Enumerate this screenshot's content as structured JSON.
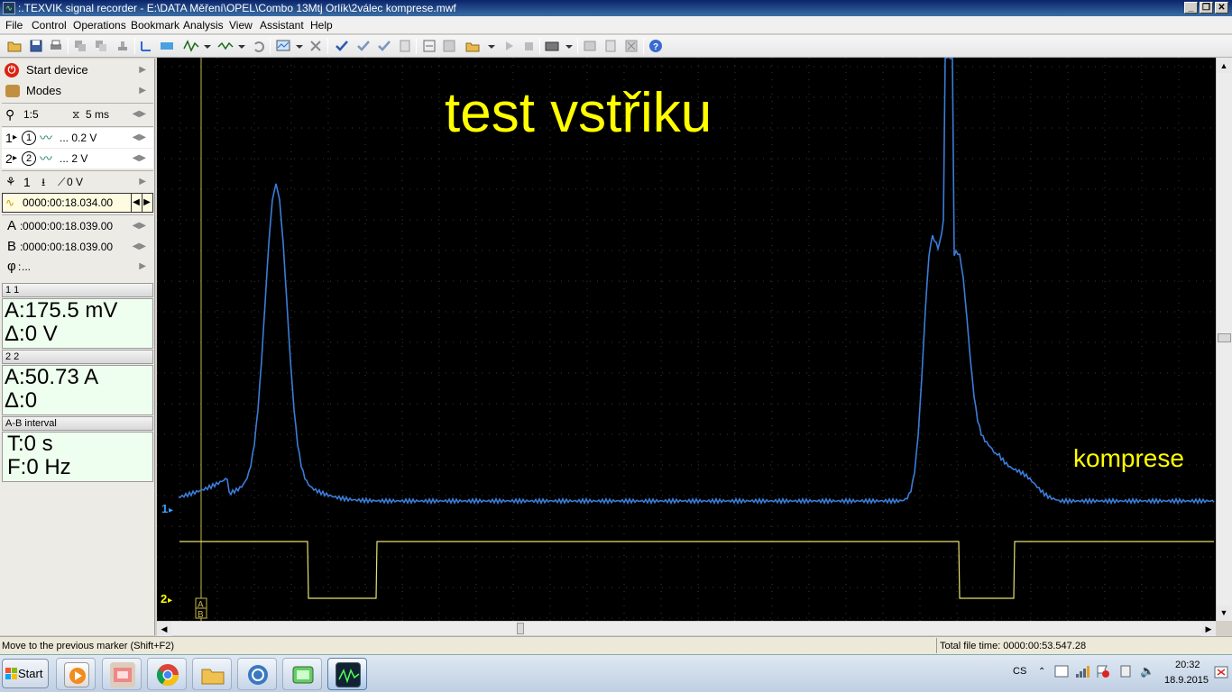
{
  "window": {
    "app_icon": "scope-app-icon",
    "title": ":.TEXVIK  signal recorder - E:\\DATA Měření\\OPEL\\Combo 13Mtj Orlík\\2válec komprese.mwf",
    "minimize": "_",
    "restore": "❐",
    "close": "✕"
  },
  "menu": [
    "File",
    "Control",
    "Operations",
    "Bookmark",
    "Analysis",
    "View",
    "Assistant",
    "Help"
  ],
  "left_panel": {
    "start_device": "Start device",
    "modes": "Modes",
    "zoom": "1:5",
    "timebase": "5 ms",
    "ch1_prefix": "1",
    "ch1_num": "1",
    "ch1_scale": "... 0.2 V",
    "ch2_prefix": "2",
    "ch2_num": "2",
    "ch2_scale": "... 2 V",
    "trigger_ch": "1",
    "trigger_level": "0 V",
    "time_position": "0000:00:18.034.00",
    "marker_a_label": "A",
    "marker_a": "0000:00:18.039.00",
    "marker_b_label": "B",
    "marker_b": "0000:00:18.039.00",
    "phi_label": "φ",
    "phi_value": "...",
    "ch1_header": "1 1",
    "ch1_a": "A:175.5 mV",
    "ch1_delta": "Δ:0 V",
    "ch2_header": "2 2",
    "ch2_a": "A:50.73 A",
    "ch2_delta": "Δ:0",
    "ab_header": "A-B interval",
    "ab_t": "T:0 s",
    "ab_f": "F:0 Hz"
  },
  "scope": {
    "annotation_title": "test vstřiku",
    "annotation_label": "komprese",
    "ch1_marker": "1",
    "ch2_marker": "2",
    "cursor_label_a": "A",
    "cursor_label_b": "B",
    "colors": {
      "background": "#000000",
      "grid": "#3a3a3a",
      "ch1": "#3b7dd8",
      "ch2": "#e8e070",
      "annotation": "#ffff00"
    }
  },
  "statusbar": {
    "hint": "Move to the previous marker (Shift+F2)",
    "total_time": "Total file time: 0000:00:53.547.28"
  },
  "taskbar": {
    "start": "Start",
    "language": "CS",
    "time": "20:32",
    "date": "18.9.2015"
  }
}
